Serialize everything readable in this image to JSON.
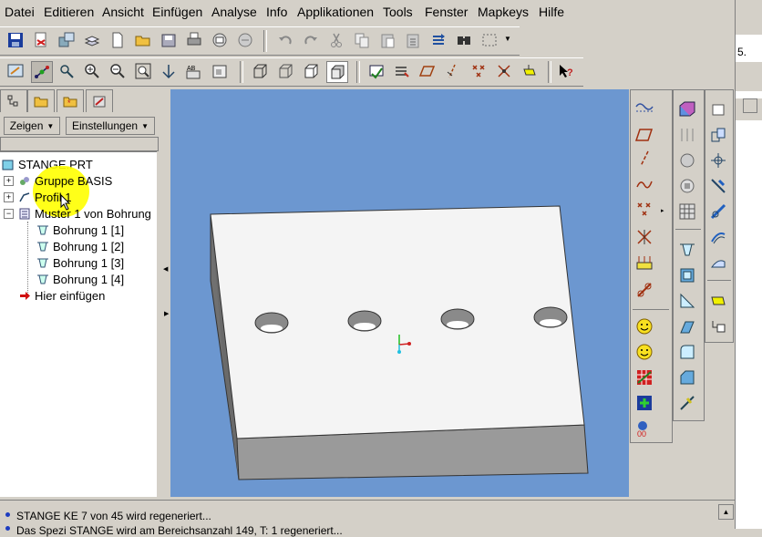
{
  "menubar": {
    "items": [
      {
        "label": "Datei"
      },
      {
        "label": "Editieren"
      },
      {
        "label": "Ansicht"
      },
      {
        "label": "Einfügen"
      },
      {
        "label": "Analyse"
      },
      {
        "label": "Info"
      },
      {
        "label": "Applikationen"
      },
      {
        "label": "Tools"
      },
      {
        "label": "Fenster"
      },
      {
        "label": "Mapkeys"
      },
      {
        "label": "Hilfe"
      }
    ]
  },
  "toolbar1": {
    "icons": [
      "save-icon",
      "print-pdf-icon",
      "export-icon",
      "layers-icon",
      "new-icon",
      "open-folder-icon",
      "save-copy-icon",
      "print-icon",
      "mail-icon",
      "mail-attach-icon",
      "undo-icon",
      "redo-icon",
      "cut-icon",
      "copy-icon",
      "paste-icon",
      "paste-special-icon",
      "regenerate-icon",
      "find-icon",
      "select-box-icon"
    ]
  },
  "toolbar2": {
    "icons": [
      "repaint-icon",
      "spin-center-icon",
      "orient-icon",
      "zoom-in-icon",
      "zoom-out-icon",
      "refit-icon",
      "reorient-icon",
      "named-views-icon",
      "view-manager-icon",
      "wireframe-icon",
      "hidden-line-icon",
      "no-hidden-icon",
      "shaded-icon",
      "datum-planes-icon",
      "datum-axes-icon",
      "datum-points-icon",
      "csys-icon",
      "annotations-icon",
      "context-help-icon"
    ]
  },
  "leftpanel": {
    "tabs": [
      "model-tree-tab",
      "folder-tab",
      "favorites-tab",
      "connections-tab"
    ],
    "show_label": "Zeigen",
    "settings_label": "Einstellungen"
  },
  "tree": {
    "root": "STANGE.PRT",
    "items": [
      {
        "label": "Gruppe BASIS",
        "icon": "group-icon"
      },
      {
        "label": "Profil 1",
        "icon": "sketch-icon"
      },
      {
        "label": "Muster 1 von Bohrung",
        "icon": "pattern-icon"
      },
      {
        "label": "Bohrung 1 [1]",
        "icon": "hole-icon"
      },
      {
        "label": "Bohrung 1 [2]",
        "icon": "hole-icon"
      },
      {
        "label": "Bohrung 1 [3]",
        "icon": "hole-icon"
      },
      {
        "label": "Bohrung 1 [4]",
        "icon": "hole-icon"
      },
      {
        "label": "Hier einfügen",
        "icon": "insert-arrow-icon"
      }
    ]
  },
  "right_window": {
    "field_text": "5."
  },
  "status": {
    "line1": "STANGE KE 7 von 45 wird regeneriert...",
    "line2": "Das Spezi STANGE wird am Bereichsanzahl 149, T: 1 regeneriert..."
  },
  "colors": {
    "viewport": "#6c97d0",
    "highlight": "#ffff00",
    "panel": "#d4d0c8"
  }
}
